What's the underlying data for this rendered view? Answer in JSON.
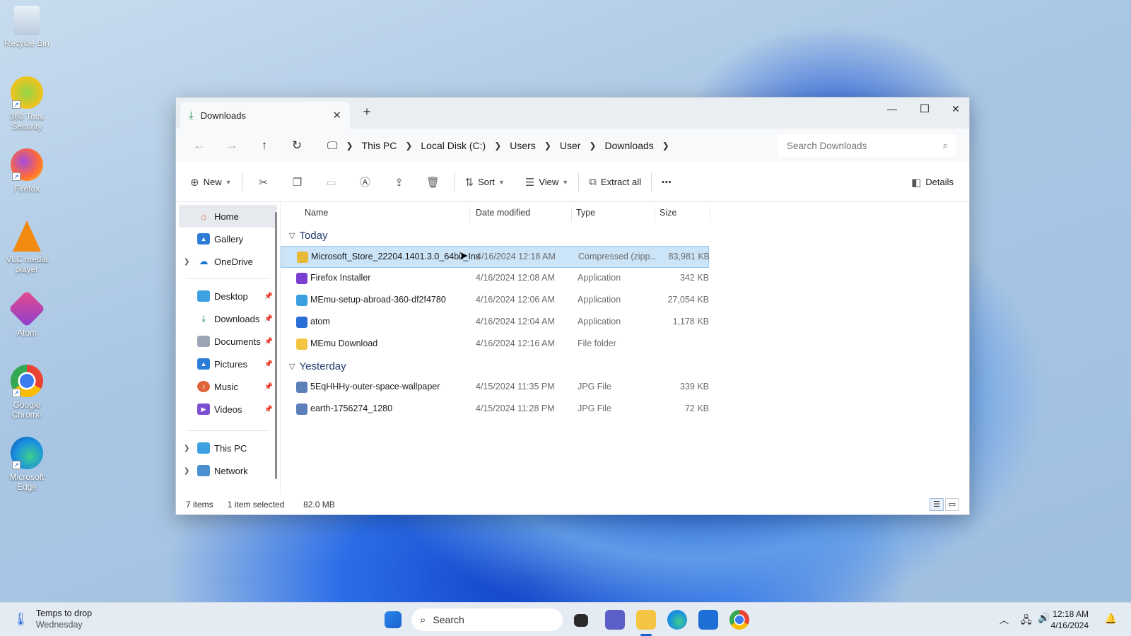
{
  "desktop": {
    "icons": [
      {
        "label": "Recycle Bin"
      },
      {
        "label": "360 Total Security"
      },
      {
        "label": "Firefox"
      },
      {
        "label": "VLC media player"
      },
      {
        "label": "Atom"
      },
      {
        "label": "Google Chrome"
      },
      {
        "label": "Microsoft Edge"
      }
    ]
  },
  "window": {
    "tab_title": "Downloads",
    "tab_close": "✕",
    "new_tab": "+",
    "minimize": "—",
    "maximize": "☐",
    "close": "✕"
  },
  "address": {
    "crumbs": [
      "This PC",
      "Local Disk (C:)",
      "Users",
      "User",
      "Downloads"
    ],
    "search_placeholder": "Search Downloads"
  },
  "toolbar": {
    "new_label": "New",
    "sort_label": "Sort",
    "view_label": "View",
    "extract_label": "Extract all",
    "more_label": "•••",
    "details_label": "Details"
  },
  "nav": {
    "home": "Home",
    "gallery": "Gallery",
    "onedrive": "OneDrive",
    "desktop": "Desktop",
    "downloads": "Downloads",
    "documents": "Documents",
    "pictures": "Pictures",
    "music": "Music",
    "videos": "Videos",
    "thispc": "This PC",
    "network": "Network"
  },
  "columns": {
    "name": "Name",
    "date": "Date modified",
    "type": "Type",
    "size": "Size"
  },
  "groups": {
    "today": "Today",
    "yesterday": "Yesterday"
  },
  "files": [
    {
      "name": "Microsoft_Store_22204.1401.3.0_64bit_Ins",
      "date": "4/16/2024 12:18 AM",
      "type": "Compressed (zipp...",
      "size": "83,981 KB",
      "icon_color": "#e8b936"
    },
    {
      "name": "Firefox Installer",
      "date": "4/16/2024 12:08 AM",
      "type": "Application",
      "size": "342 KB",
      "icon_color": "#7a3fd1"
    },
    {
      "name": "MEmu-setup-abroad-360-df2f4780",
      "date": "4/16/2024 12:06 AM",
      "type": "Application",
      "size": "27,054 KB",
      "icon_color": "#3aa0e0"
    },
    {
      "name": "atom",
      "date": "4/16/2024 12:04 AM",
      "type": "Application",
      "size": "1,178 KB",
      "icon_color": "#2a6fd6"
    },
    {
      "name": "MEmu Download",
      "date": "4/16/2024 12:16 AM",
      "type": "File folder",
      "size": "",
      "icon_color": "#f4c542"
    },
    {
      "name": "5EqHHHy-outer-space-wallpaper",
      "date": "4/15/2024 11:35 PM",
      "type": "JPG File",
      "size": "339 KB",
      "icon_color": "#5b7fb8"
    },
    {
      "name": "earth-1756274_1280",
      "date": "4/15/2024 11:28 PM",
      "type": "JPG File",
      "size": "72 KB",
      "icon_color": "#5b7fb8"
    }
  ],
  "status": {
    "count": "7 items",
    "selected": "1 item selected",
    "size": "82.0 MB"
  },
  "taskbar": {
    "weather_title": "Temps to drop",
    "weather_sub": "Wednesday",
    "search": "Search",
    "time": "12:18 AM",
    "date": "4/16/2024"
  }
}
